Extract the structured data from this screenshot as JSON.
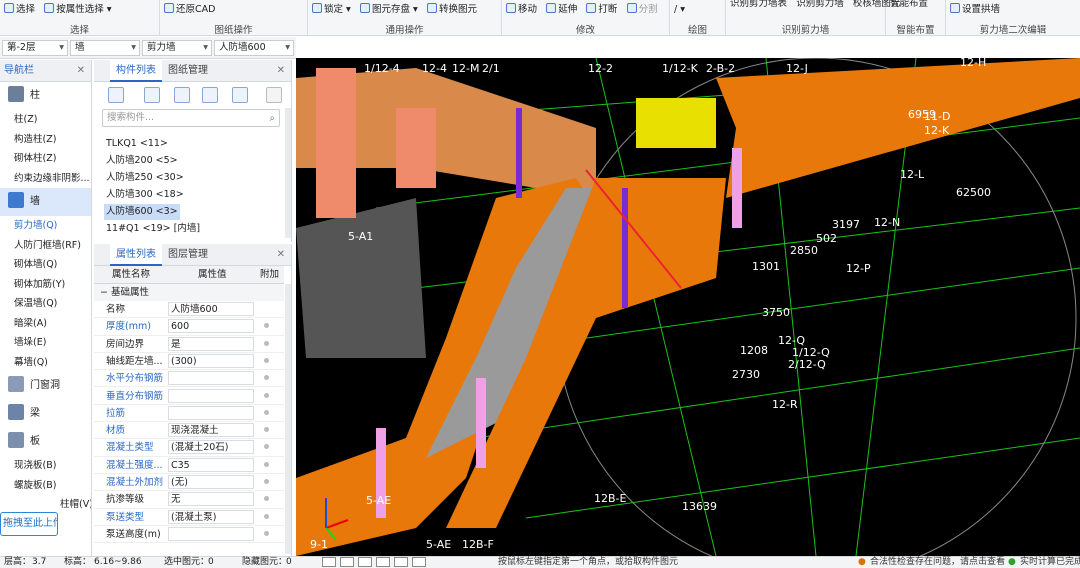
{
  "ribbon": {
    "groups": [
      {
        "label": "选择",
        "items": [
          {
            "label": "选择"
          },
          {
            "label": "按属性选择"
          }
        ]
      },
      {
        "label": "图纸操作",
        "items": [
          {
            "label": "还原CAD"
          }
        ]
      },
      {
        "label": "通用操作",
        "items": [
          {
            "label": "锁定"
          },
          {
            "label": "图元存盘"
          },
          {
            "label": "转换图元"
          }
        ]
      },
      {
        "label": "修改",
        "items": [
          {
            "label": "移动"
          },
          {
            "label": "延伸"
          },
          {
            "label": "打断"
          },
          {
            "label": "分割"
          }
        ]
      },
      {
        "label": "绘图",
        "items": [
          {
            "label": "/"
          }
        ]
      },
      {
        "label": "识别剪力墙",
        "items": [
          {
            "label": "识别剪力墙表"
          },
          {
            "label": "识别剪力墙"
          },
          {
            "label": "校核墙图元"
          }
        ]
      },
      {
        "label": "智能布置",
        "items": [
          {
            "label": "智能布置"
          }
        ]
      },
      {
        "label": "剪力墙二次编辑",
        "items": [
          {
            "label": "设置拱墙"
          }
        ]
      }
    ]
  },
  "selectors": {
    "floor": "第-2层",
    "category": "墙",
    "type": "剪力墙",
    "component": "人防墙600"
  },
  "nav": {
    "title": "导航栏",
    "cats": [
      {
        "label": "柱",
        "items": [
          "柱(Z)",
          "构造柱(Z)",
          "砌体柱(Z)",
          "约束边缘非阴影..."
        ]
      },
      {
        "label": "墙",
        "items": [
          "剪力墙(Q)",
          "人防门框墙(RF)",
          "砌体墙(Q)",
          "砌体加筋(Y)",
          "保温墙(Q)",
          "暗梁(A)",
          "墙垛(E)",
          "幕墙(Q)"
        ]
      },
      {
        "label": "门窗洞",
        "items": []
      },
      {
        "label": "梁",
        "items": []
      },
      {
        "label": "板",
        "items": [
          "现浇板(B)",
          "螺旋板(B)",
          "柱帽(V)"
        ]
      }
    ],
    "upload_label": "拖拽至此上传"
  },
  "components": {
    "tab_list": "构件列表",
    "tab_drawing": "图纸管理",
    "search_placeholder": "搜索构件...",
    "items": [
      "TLKQ1 <11>",
      "人防墙200 <5>",
      "人防墙250 <30>",
      "人防墙300 <18>",
      "人防墙600 <3>",
      "11#Q1 <19> [内墙]"
    ]
  },
  "properties": {
    "tab_list": "属性列表",
    "tab_layer": "图层管理",
    "col_name": "属性名称",
    "col_value": "属性值",
    "col_extra": "附加",
    "group": "基础属性",
    "rows": [
      {
        "name": "名称",
        "value": "人防墙600"
      },
      {
        "name": "厚度(mm)",
        "value": "600"
      },
      {
        "name": "房间边界",
        "value": "是"
      },
      {
        "name": "轴线距左墙...",
        "value": "(300)"
      },
      {
        "name": "水平分布钢筋",
        "value": ""
      },
      {
        "name": "垂直分布钢筋",
        "value": ""
      },
      {
        "name": "拉筋",
        "value": ""
      },
      {
        "name": "材质",
        "value": "现浇混凝土"
      },
      {
        "name": "混凝土类型",
        "value": "(混凝土20石)"
      },
      {
        "name": "混凝土强度...",
        "value": "C35"
      },
      {
        "name": "混凝土外加剂",
        "value": "(无)"
      },
      {
        "name": "抗渗等级",
        "value": "无"
      },
      {
        "name": "泵送类型",
        "value": "(混凝土泵)"
      },
      {
        "name": "泵送高度(m)",
        "value": ""
      }
    ]
  },
  "viewport": {
    "labels": [
      "1/12-4",
      "12-4",
      "12-M",
      "2/1",
      "12-2",
      "1/12-K",
      "2-B-2",
      "12-J",
      "12-H",
      "12-K",
      "11-D",
      "12-L",
      "12-N",
      "12-P",
      "12-Q",
      "1/12-Q",
      "2/12-Q",
      "12-R",
      "12B-E",
      "5-A1",
      "5-AE",
      "5-AE",
      "12B-F",
      "9-1",
      "6959",
      "2850",
      "502",
      "3197",
      "1301",
      "3750",
      "2730",
      "1208",
      "13639",
      "62500"
    ]
  },
  "status": {
    "floor_height_label": "层高：",
    "floor_height": "3.7",
    "elev_label": "标高：",
    "elev": "6.16~9.86",
    "selected_label": "选中图元：",
    "selected": "0",
    "hidden_label": "隐藏图元：",
    "hidden": "0",
    "hint": "按鼠标左键指定第一个角点，或拾取构件图元",
    "check": "合法性检查存在问题，请点击查看",
    "realtime": "实时计算已完成"
  },
  "colors": {
    "accent": "#2a66c4",
    "wall_orange": "#e9780a",
    "viewport_bg": "#000000",
    "grid_green": "#19c319",
    "purple": "#7a2bd6",
    "yellow": "#e8e000",
    "pink": "#f0a0e6"
  }
}
